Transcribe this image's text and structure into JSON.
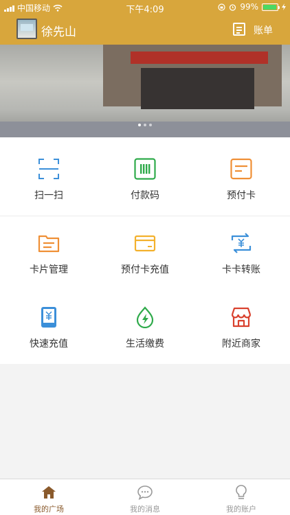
{
  "status_bar": {
    "carrier": "中国移动",
    "time": "下午4:09",
    "battery": "99%"
  },
  "header": {
    "nickname": "徐先山",
    "bill_label": "账单"
  },
  "banner": {
    "slides": 3,
    "active_slide": 1
  },
  "actions": [
    {
      "label": "扫一扫",
      "icon": "scan-icon"
    },
    {
      "label": "付款码",
      "icon": "barcode-icon"
    },
    {
      "label": "预付卡",
      "icon": "prepaid-card-icon"
    },
    {
      "label": "卡片管理",
      "icon": "card-folder-icon"
    },
    {
      "label": "预付卡充值",
      "icon": "card-recharge-icon"
    },
    {
      "label": "卡卡转账",
      "icon": "transfer-icon"
    },
    {
      "label": "快速充值",
      "icon": "phone-recharge-icon"
    },
    {
      "label": "生活缴费",
      "icon": "utility-icon"
    },
    {
      "label": "附近商家",
      "icon": "store-icon"
    }
  ],
  "tabs": [
    {
      "label": "我的广场",
      "icon": "home-icon"
    },
    {
      "label": "我的消息",
      "icon": "message-icon"
    },
    {
      "label": "我的账户",
      "icon": "account-icon"
    }
  ],
  "colors": {
    "accent": "#d8a63c",
    "tab_active": "#8a5a2c",
    "blue": "#3b8fd9",
    "green": "#2eaa4a",
    "orange": "#ef8f35",
    "yellow": "#f3b12c",
    "red": "#d9412e"
  }
}
